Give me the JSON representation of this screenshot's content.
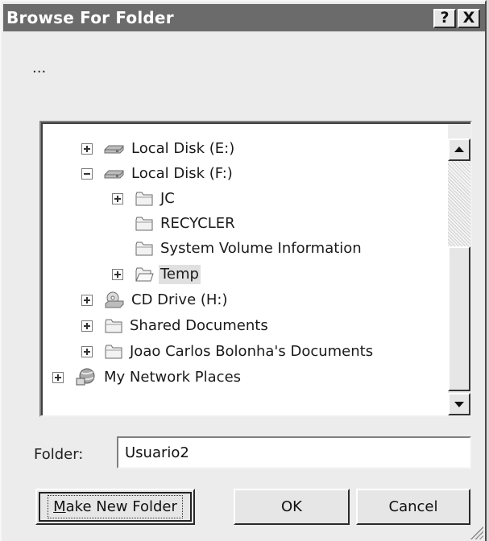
{
  "window": {
    "title": "Browse For Folder",
    "help_label": "?",
    "close_label": "X",
    "description": "..."
  },
  "tree": {
    "items": [
      {
        "label": "Local Disk (E:)",
        "icon": "drive-icon",
        "expander": "plus",
        "selected": false
      },
      {
        "label": "Local Disk (F:)",
        "icon": "drive-icon",
        "expander": "minus",
        "selected": false
      },
      {
        "label": "JC",
        "icon": "folder-icon",
        "expander": "plus",
        "selected": false
      },
      {
        "label": "RECYCLER",
        "icon": "folder-icon",
        "expander": "none",
        "selected": false
      },
      {
        "label": "System Volume Information",
        "icon": "folder-icon",
        "expander": "none",
        "selected": false
      },
      {
        "label": "Temp",
        "icon": "folder-icon",
        "expander": "plus",
        "selected": true
      },
      {
        "label": "CD Drive (H:)",
        "icon": "cd-drive-icon",
        "expander": "plus",
        "selected": false
      },
      {
        "label": "Shared Documents",
        "icon": "folder-icon",
        "expander": "plus",
        "selected": false
      },
      {
        "label": "Joao Carlos Bolonha's Documents",
        "icon": "folder-icon",
        "expander": "plus",
        "selected": false
      },
      {
        "label": "My Network Places",
        "icon": "network-places-icon",
        "expander": "plus",
        "selected": false
      }
    ]
  },
  "folder": {
    "label": "Folder:",
    "value": "Usuario2"
  },
  "buttons": {
    "make_new_folder_prefix": "M",
    "make_new_folder_rest": "ake New Folder",
    "ok": "OK",
    "cancel": "Cancel"
  },
  "colors": {
    "titlebar": "#6b6b6b",
    "dialog": "#ececec",
    "selection": "#e0e0e0"
  }
}
